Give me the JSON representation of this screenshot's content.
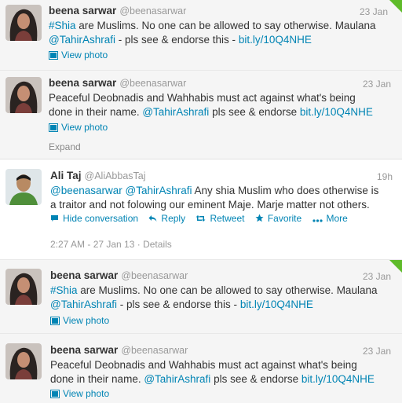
{
  "tweets": [
    {
      "fullname": "beena sarwar",
      "username": "@beenasarwar",
      "time": "23 Jan",
      "lines": [
        [
          {
            "t": "#Shia",
            "link": true
          },
          {
            "t": " are Muslims. No one can be allowed to say otherwise. Maulana"
          }
        ],
        [
          {
            "t": "@TahirAshrafi",
            "link": true
          },
          {
            "t": " - pls see & endorse this - "
          },
          {
            "t": "bit.ly/10Q4NHE",
            "link": true
          }
        ]
      ],
      "view_photo": "View photo"
    },
    {
      "fullname": "beena sarwar",
      "username": "@beenasarwar",
      "time": "23 Jan",
      "lines": [
        [
          {
            "t": "Peaceful Deobnadis and Wahhabis must act against what's being"
          }
        ],
        [
          {
            "t": "done in their name. "
          },
          {
            "t": "@TahirAshrafi",
            "link": true
          },
          {
            "t": " pls see & endorse "
          },
          {
            "t": "bit.ly/10Q4NHE",
            "link": true
          }
        ]
      ],
      "view_photo": "View photo"
    },
    {
      "fullname": "Ali Taj",
      "username": "@AliAbbasTaj",
      "time": "19h",
      "lines": [
        [
          {
            "t": "@beenasarwar",
            "link": true
          },
          {
            "t": " "
          },
          {
            "t": "@TahirAshrafi",
            "link": true
          },
          {
            "t": " Any shia Muslim who does otherwise is"
          }
        ],
        [
          {
            "t": "a traitor and not folowing our eminent Maje. Marje matter not others."
          }
        ]
      ]
    },
    {
      "fullname": "beena sarwar",
      "username": "@beenasarwar",
      "time": "23 Jan",
      "lines": [
        [
          {
            "t": "#Shia",
            "link": true
          },
          {
            "t": " are Muslims. No one can be allowed to say otherwise. Maulana"
          }
        ],
        [
          {
            "t": "@TahirAshrafi",
            "link": true
          },
          {
            "t": " - pls see & endorse this - "
          },
          {
            "t": "bit.ly/10Q4NHE",
            "link": true
          }
        ]
      ],
      "view_photo": "View photo"
    },
    {
      "fullname": "beena sarwar",
      "username": "@beenasarwar",
      "time": "23 Jan",
      "lines": [
        [
          {
            "t": "Peaceful Deobnadis and Wahhabis must act against what's being"
          }
        ],
        [
          {
            "t": "done in their name. "
          },
          {
            "t": "@TahirAshrafi",
            "link": true
          },
          {
            "t": " pls see & endorse "
          },
          {
            "t": "bit.ly/10Q4NHE",
            "link": true
          }
        ]
      ],
      "view_photo": "View photo"
    }
  ],
  "expand_label": "Expand",
  "actions": {
    "hide_conversation": "Hide conversation",
    "reply": "Reply",
    "retweet": "Retweet",
    "favorite": "Favorite",
    "more": "More"
  },
  "focus_meta": {
    "timestamp": "2:27 AM - 27 Jan 13",
    "separator": "·",
    "details": "Details"
  },
  "colors": {
    "link": "#0084b4",
    "retweet_corner": "#5fbb2a",
    "muted": "#999999"
  },
  "icons": {
    "photo": "photo-icon",
    "conversation": "speech-bubble-icon",
    "reply": "reply-arrow-icon",
    "retweet": "retweet-icon",
    "favorite": "star-icon",
    "more": "dots-icon",
    "retweet_corner": "retweet-corner-icon"
  }
}
